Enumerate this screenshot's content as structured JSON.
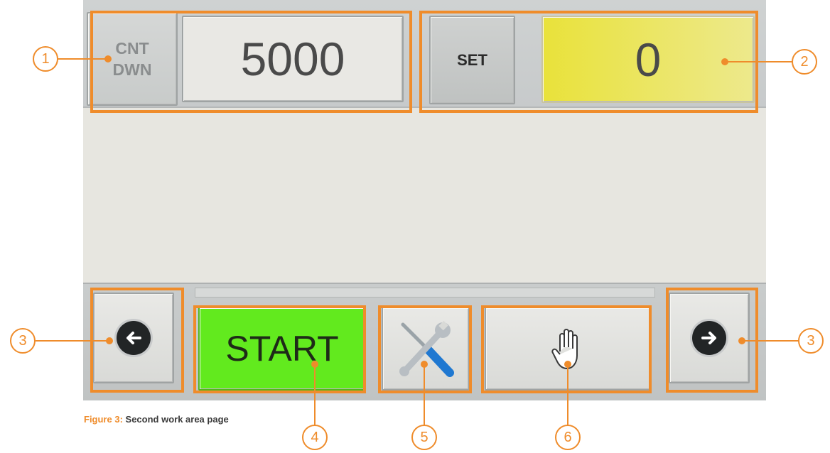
{
  "counter": {
    "mode_line1": "CNT",
    "mode_line2": "DWN",
    "value": "5000"
  },
  "setpoint": {
    "button_label": "SET",
    "value": "0"
  },
  "controls": {
    "start_label": "START",
    "back_icon": "arrow-left-circle-icon",
    "next_icon": "arrow-right-circle-icon",
    "tools_icon": "wrench-screwdriver-icon",
    "stop_icon": "hand-stop-icon"
  },
  "callouts": [
    "1",
    "2",
    "3",
    "3",
    "4",
    "5",
    "6"
  ],
  "caption": {
    "figure_label": "Figure 3:",
    "text": " Second work area page"
  },
  "colors": {
    "highlight": "#ef8c2b",
    "start_green": "#62ea1e",
    "set_yellow": "#e9e23a"
  }
}
